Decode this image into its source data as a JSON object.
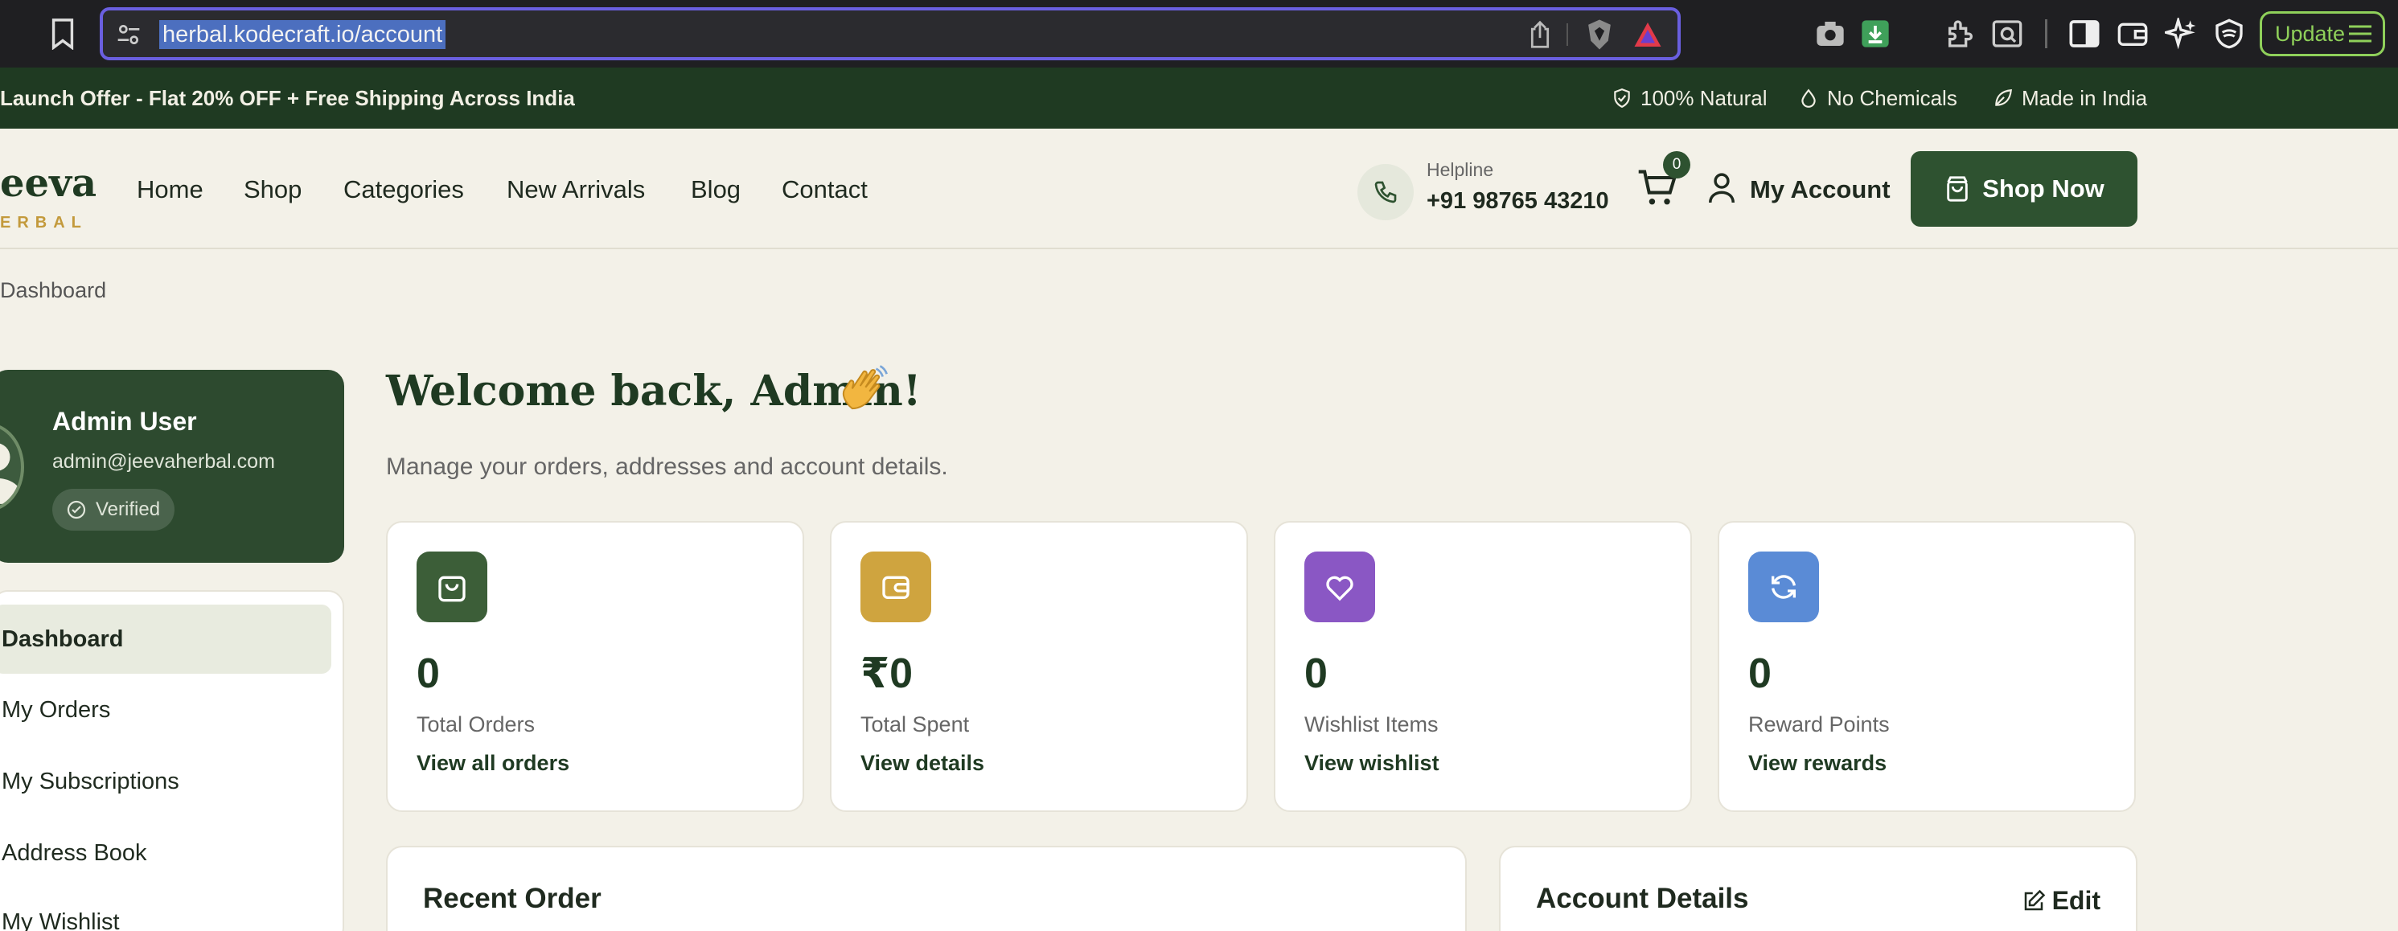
{
  "browser": {
    "url": "herbal.kodecraft.io/account",
    "update_label": "Update"
  },
  "announcement": {
    "offer": "Launch Offer - Flat 20% OFF + Free Shipping Across India",
    "badges": [
      "100% Natural",
      "No Chemicals",
      "Made in India"
    ]
  },
  "header": {
    "logo_main": "eeva",
    "logo_sub": "ERBAL",
    "nav": [
      "Home",
      "Shop",
      "Categories",
      "New Arrivals",
      "Blog",
      "Contact"
    ],
    "helpline_label": "Helpline",
    "helpline_number": "+91 98765 43210",
    "cart_count": "0",
    "account_label": "My Account",
    "shop_now_label": "Shop Now"
  },
  "breadcrumb": "Dashboard",
  "profile": {
    "name": "Admin User",
    "email": "admin@jeevaherbal.com",
    "status": "Verified"
  },
  "sidebar": {
    "items": [
      "Dashboard",
      "My Orders",
      "My Subscriptions",
      "Address Book",
      "My Wishlist"
    ],
    "active": "Dashboard"
  },
  "main": {
    "welcome": "Welcome back, Admin!",
    "subtitle": "Manage your orders, addresses and account details.",
    "stats": [
      {
        "value": "0",
        "label": "Total Orders",
        "link": "View all orders",
        "color": "#3c5e38",
        "icon": "bag-icon"
      },
      {
        "value": "₹0",
        "label": "Total Spent",
        "link": "View details",
        "color": "#cfa43f",
        "icon": "wallet-icon"
      },
      {
        "value": "0",
        "label": "Wishlist Items",
        "link": "View wishlist",
        "color": "#8a57c4",
        "icon": "heart-icon"
      },
      {
        "value": "0",
        "label": "Reward Points",
        "link": "View rewards",
        "color": "#5a8bd6",
        "icon": "refresh-icon"
      }
    ],
    "recent_order_title": "Recent Order",
    "account_details_title": "Account Details",
    "edit_label": "Edit"
  },
  "colors": {
    "brand_dark": "#1f3a22",
    "brand": "#2e5230",
    "accent_gold": "#c39a3c",
    "page_bg": "#f3f1e8"
  }
}
